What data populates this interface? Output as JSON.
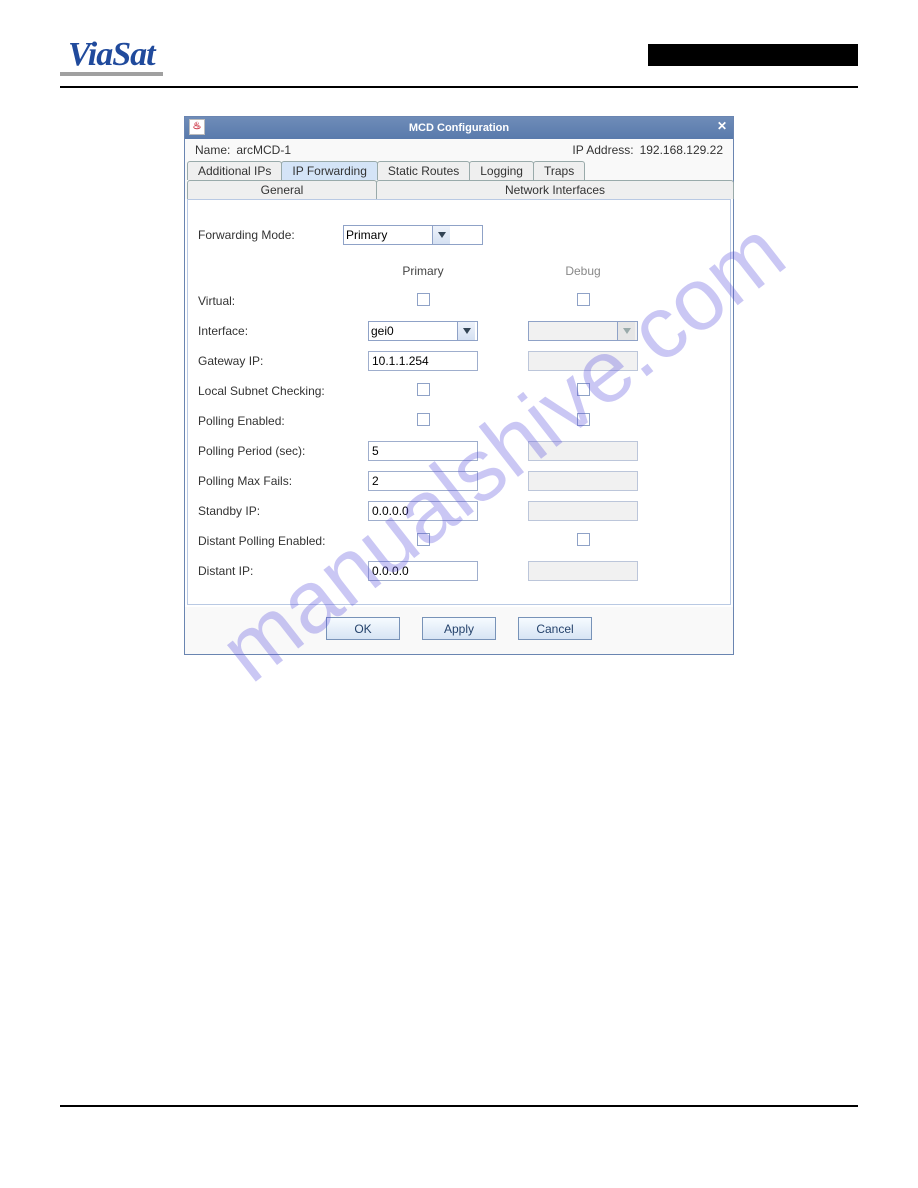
{
  "logo": "ViaSat",
  "watermark": "manualshive.com",
  "dialog": {
    "title": "MCD Configuration",
    "name_label": "Name:",
    "name_value": "arcMCD-1",
    "ip_label": "IP Address:",
    "ip_value": "192.168.129.22",
    "tabs1": {
      "additional_ips": "Additional IPs",
      "ip_forwarding": "IP Forwarding",
      "static_routes": "Static Routes",
      "logging": "Logging",
      "traps": "Traps"
    },
    "tabs2": {
      "general": "General",
      "network_if": "Network Interfaces"
    },
    "form": {
      "forwarding_mode_label": "Forwarding Mode:",
      "forwarding_mode_value": "Primary",
      "col_primary": "Primary",
      "col_debug": "Debug",
      "virtual_label": "Virtual:",
      "interface_label": "Interface:",
      "interface_value": "gei0",
      "gateway_label": "Gateway IP:",
      "gateway_value": "10.1.1.254",
      "local_subnet_label": "Local Subnet Checking:",
      "polling_enabled_label": "Polling Enabled:",
      "polling_period_label": "Polling Period (sec):",
      "polling_period_value": "5",
      "polling_max_fails_label": "Polling Max Fails:",
      "polling_max_fails_value": "2",
      "standby_ip_label": "Standby IP:",
      "standby_ip_value": "0.0.0.0",
      "distant_polling_label": "Distant Polling Enabled:",
      "distant_ip_label": "Distant IP:",
      "distant_ip_value": "0.0.0.0"
    },
    "buttons": {
      "ok": "OK",
      "apply": "Apply",
      "cancel": "Cancel"
    }
  }
}
